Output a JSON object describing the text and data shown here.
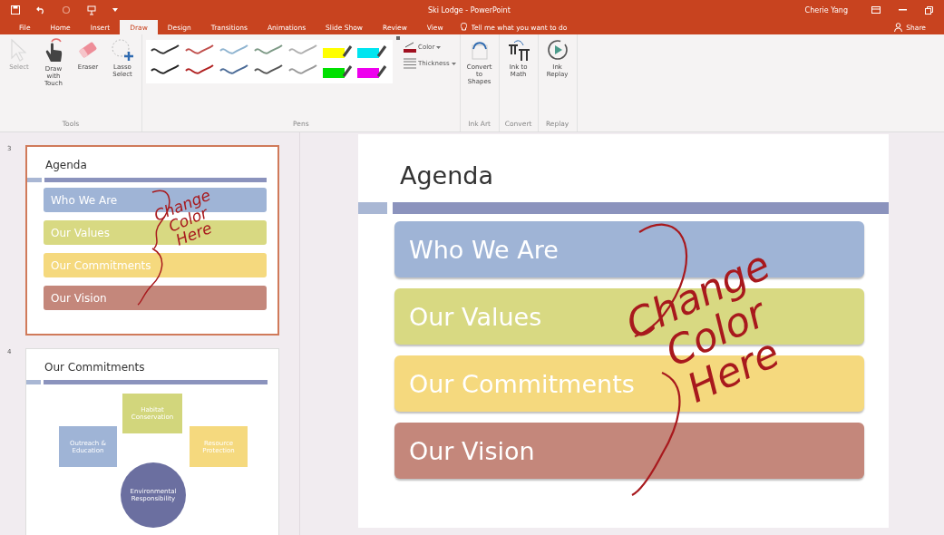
{
  "title_bar": {
    "title": "Ski Lodge - PowerPoint",
    "user": "Cherie Yang"
  },
  "tabs": [
    {
      "label": "File",
      "selected": false
    },
    {
      "label": "Home",
      "selected": false
    },
    {
      "label": "Insert",
      "selected": false
    },
    {
      "label": "Draw",
      "selected": true
    },
    {
      "label": "Design",
      "selected": false
    },
    {
      "label": "Transitions",
      "selected": false
    },
    {
      "label": "Animations",
      "selected": false
    },
    {
      "label": "Slide Show",
      "selected": false
    },
    {
      "label": "Review",
      "selected": false
    },
    {
      "label": "View",
      "selected": false
    }
  ],
  "tell_me": {
    "placeholder": "Tell me what you want to do"
  },
  "share": "Share",
  "ribbon": {
    "tools": {
      "label": "Tools",
      "items": [
        {
          "kind": "select",
          "label": "Select",
          "disabled": true
        },
        {
          "kind": "touch",
          "label": "Draw with Touch",
          "disabled": false
        },
        {
          "kind": "eraser",
          "label": "Eraser",
          "disabled": false
        },
        {
          "kind": "lasso",
          "label": "Lasso Select",
          "disabled": false
        }
      ]
    },
    "pens": {
      "label": "Pens",
      "items": [
        {
          "kind": "pen",
          "color": "#333333",
          "selected": false
        },
        {
          "kind": "pen",
          "color": "#c0504d",
          "selected": false
        },
        {
          "kind": "pen",
          "color": "#8fb4d0",
          "selected": false
        },
        {
          "kind": "pen",
          "color": "#7d9a86",
          "selected": false
        },
        {
          "kind": "pen",
          "color": "#b0b0b0",
          "selected": false
        },
        {
          "kind": "highlighter",
          "color": "#ffff00",
          "selected": false
        },
        {
          "kind": "highlighter",
          "color": "#00e5f0",
          "selected": false
        },
        {
          "kind": "pen",
          "color": "#222222",
          "selected": false
        },
        {
          "kind": "pen",
          "color": "#b02020",
          "selected": false
        },
        {
          "kind": "pen",
          "color": "#4a6a96",
          "selected": false
        },
        {
          "kind": "pen",
          "color": "#555555",
          "selected": false
        },
        {
          "kind": "pen",
          "color": "#999999",
          "selected": false
        },
        {
          "kind": "highlighter",
          "color": "#00e000",
          "selected": false
        },
        {
          "kind": "highlighter",
          "color": "#ee00ee",
          "selected": false
        }
      ],
      "color_button": "Color",
      "thickness_button": "Thickness"
    },
    "ink_art": {
      "label": "Ink Art",
      "button": "Convert to Shapes"
    },
    "convert": {
      "label": "Convert",
      "button": "Ink to Math"
    },
    "replay": {
      "label": "Replay",
      "button": "Ink Replay"
    }
  },
  "thumbnails": [
    {
      "kind": "list",
      "number": "3",
      "selected": true,
      "title": "Agenda",
      "items": [
        {
          "label": "Who We Are",
          "color": "#9fb4d6"
        },
        {
          "label": "Our Values",
          "color": "#d8d982"
        },
        {
          "label": "Our Commitments",
          "color": "#f5d97e"
        },
        {
          "label": "Our Vision",
          "color": "#c4877b"
        }
      ],
      "ink_lines": [
        "Change",
        "Color",
        "Here"
      ]
    },
    {
      "kind": "diagram",
      "number": "4",
      "selected": false,
      "title": "Our Commitments",
      "nodes": [
        {
          "label": "Habitat Conservation",
          "color": "#d2d67c"
        },
        {
          "label": "Outreach & Education",
          "color": "#9fb4d6"
        },
        {
          "label": "Resource Protection",
          "color": "#f5d97e"
        },
        {
          "label": "Environmental Responsibility",
          "color": "#6b6fa0"
        }
      ]
    }
  ],
  "slide": {
    "title": "Agenda",
    "items": [
      {
        "label": "Who We Are",
        "color": "#9fb4d6"
      },
      {
        "label": "Our Values",
        "color": "#d8d982"
      },
      {
        "label": "Our Commitments",
        "color": "#f5d97e"
      },
      {
        "label": "Our Vision",
        "color": "#c4877b"
      }
    ],
    "ink_lines": [
      "Change",
      "Color",
      "Here"
    ]
  }
}
